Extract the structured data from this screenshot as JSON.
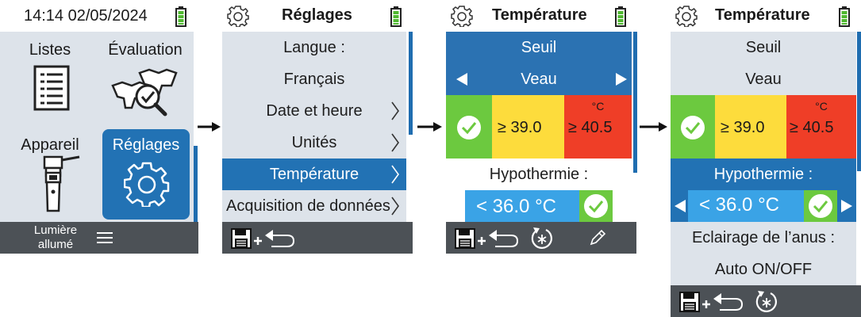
{
  "screen1": {
    "datetime": "14:14 02/05/2024",
    "tiles": [
      {
        "label": "Listes",
        "icon": "list-document-icon"
      },
      {
        "label": "Évaluation",
        "icon": "cattle-check-magnifier-icon"
      },
      {
        "label": "Appareil",
        "icon": "thermometer-device-icon"
      },
      {
        "label": "Réglages",
        "icon": "gear-icon"
      }
    ],
    "footer": {
      "line1": "Lumière",
      "line2": "allumé",
      "menu_icon": "hamburger-icon"
    }
  },
  "screen2": {
    "title": "Réglages",
    "items": [
      "Langue :",
      "Français",
      "Date et heure",
      "Unités",
      "Température",
      "Acquisition de données"
    ],
    "selected": "Température",
    "footer_icons": [
      "save-icon",
      "plus-icon",
      "back-arrow-icon"
    ]
  },
  "screen3": {
    "title": "Température",
    "threshold_label": "Seuil",
    "animal": "Veau",
    "green_check": "check-icon",
    "yellow_value": "≥ 39.0",
    "red_unit": "°C",
    "red_value": "≥ 40.5",
    "hypo_label": "Hypothermie :",
    "hypo_value": "< 36.0 °C",
    "footer_icons": [
      "save-icon",
      "plus-icon",
      "back-arrow-icon",
      "reset-icon",
      "pencil-icon"
    ]
  },
  "screen4": {
    "title": "Température",
    "threshold_label": "Seuil",
    "animal": "Veau",
    "yellow_value": "≥ 39.0",
    "red_unit": "°C",
    "red_value": "≥ 40.5",
    "hypo_label": "Hypothermie :",
    "hypo_value": "< 36.0 °C",
    "anus_label": "Eclairage de l’anus :",
    "anus_value": "Auto ON/OFF",
    "footer_icons": [
      "save-icon",
      "plus-icon",
      "back-arrow-icon",
      "reset-icon"
    ]
  },
  "colors": {
    "blue": "#2272b4",
    "light_blue": "#3aa3e6",
    "green": "#6cc93f",
    "yellow": "#fddc3c",
    "red": "#ef3e27",
    "panel": "#dde3ea",
    "footer": "#4c5156"
  }
}
